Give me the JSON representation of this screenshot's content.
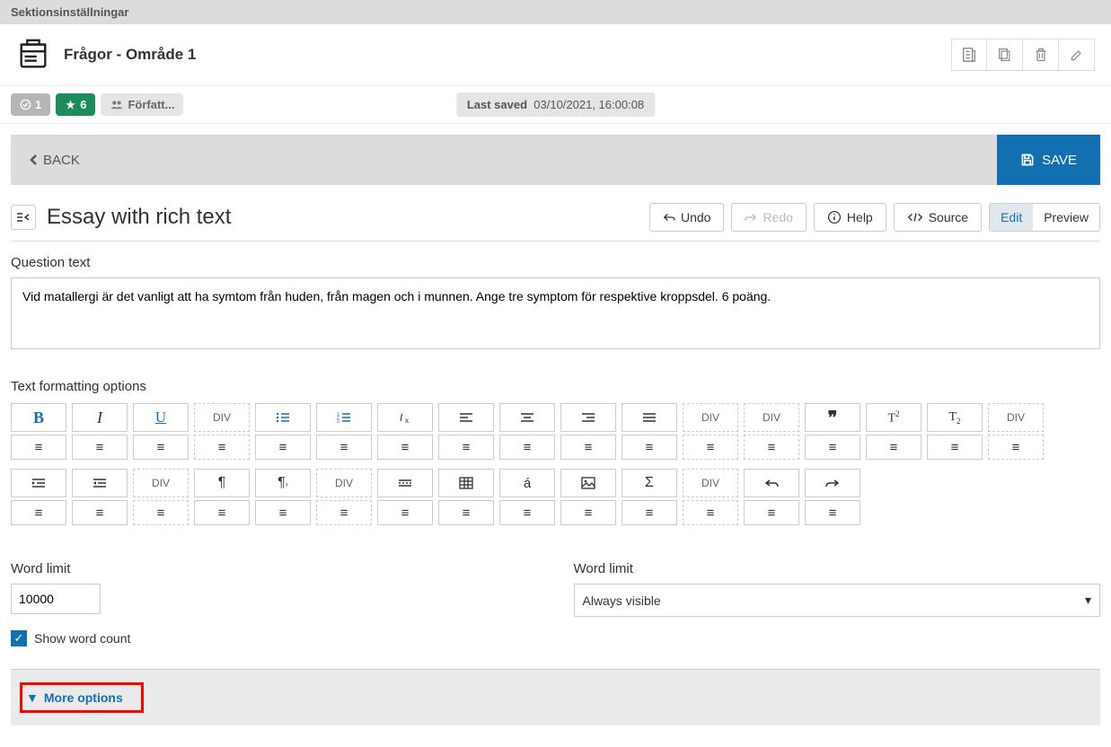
{
  "header": {
    "title": "Sektionsinställningar"
  },
  "title_row": {
    "title": "Frågor - Område 1"
  },
  "badges": {
    "check": "1",
    "star": "6",
    "author": "Författ..."
  },
  "last_saved": {
    "label": "Last saved",
    "value": "03/10/2021, 16:00:08"
  },
  "back_label": "BACK",
  "save_label": "SAVE",
  "editor": {
    "title": "Essay with rich text",
    "undo": "Undo",
    "redo": "Redo",
    "help": "Help",
    "source": "Source",
    "edit": "Edit",
    "preview": "Preview"
  },
  "question": {
    "label": "Question text",
    "text": "Vid matallergi är det vanligt att ha symtom från huden, från magen och i munnen. Ange tre symptom för respektive kroppsdel. 6 poäng."
  },
  "format_label": "Text formatting options",
  "fmt_div": "DIV",
  "word_limit": {
    "label1": "Word limit",
    "value": "10000",
    "label2": "Word limit",
    "select_value": "Always visible"
  },
  "show_word_count": "Show word count",
  "more_options": "More options"
}
